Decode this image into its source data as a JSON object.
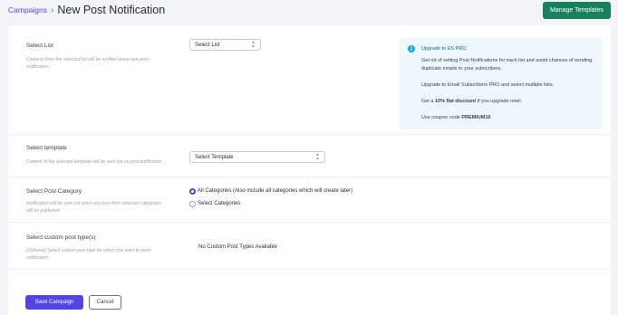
{
  "header": {
    "breadcrumb": "Campaigns",
    "separator": "›",
    "title": "New Post Notification",
    "manage_templates": "Manage Templates"
  },
  "list_row": {
    "label": "Select List",
    "help": "Contacts from the selected list will be notified about new post notification.",
    "select_value": "Select List"
  },
  "promo": {
    "icon": "i",
    "title": "Upgrade to ES PRO",
    "line1": "Get rid of setting Post Notifications for each list and avoid chances of sending duplicate emails to your subscribers.",
    "line2": "Upgrade to Email Subscribers PRO and select multiple lists.",
    "discount_pre": "Get a ",
    "discount_bold": "10% flat discount",
    "discount_post": " if you upgrade now!.",
    "coupon_pre": "Use coupon code ",
    "coupon_code": "PREMIUM10"
  },
  "template_row": {
    "label": "Select template",
    "help": "Content of the selected template will be sent out as post notification.",
    "select_value": "Select Template"
  },
  "category_row": {
    "label": "Select Post Category",
    "help": "Notification will be sent out when any post from selected categories will be published.",
    "options": [
      {
        "label": "All Categories (Also include all categories which will create later)",
        "selected": true
      },
      {
        "label": "Select Categories",
        "selected": false
      }
    ]
  },
  "posttype_row": {
    "label": "Select custom post type(s)",
    "help": "(Optional) Select custom post type for which you want to send notification.",
    "value": "No Custom Post Types Available"
  },
  "actions": {
    "save": "Save Campaign",
    "cancel": "Cancel"
  },
  "colors": {
    "accent": "#4f46e5",
    "manage_btn": "#16815d",
    "info": "#0ea5e9"
  }
}
